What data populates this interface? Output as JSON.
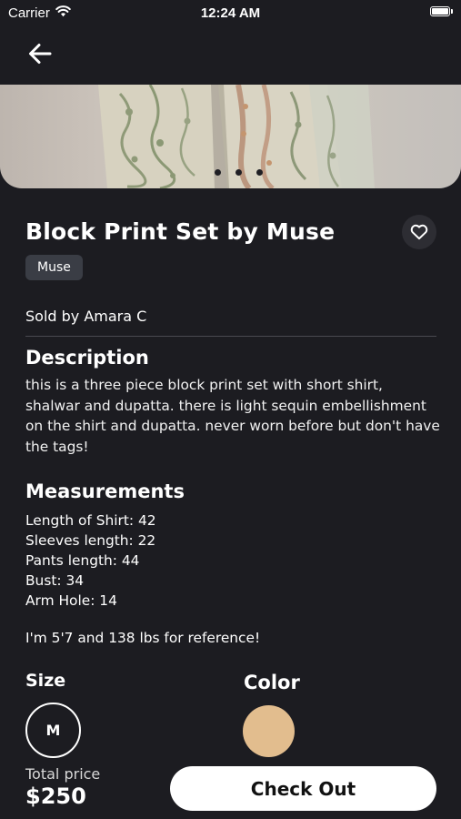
{
  "status_bar": {
    "carrier": "Carrier",
    "time": "12:24 AM",
    "icons": [
      "wifi-icon",
      "battery-icon"
    ]
  },
  "navigation": {
    "back_icon": "arrow-left-icon"
  },
  "gallery": {
    "page_count": 3,
    "active_index": 0
  },
  "product": {
    "title": "Block Print Set by Muse",
    "brand_tag": "Muse",
    "seller_text": "Sold by Amara C",
    "favorite_icon": "heart-icon"
  },
  "description": {
    "heading": "Description",
    "text": "this is a three piece block print set with short shirt, shalwar and dupatta. there is light sequin embellishment on the shirt and dupatta. never worn before but don't have the tags!"
  },
  "measurements": {
    "heading": "Measurements",
    "items": [
      "Length of Shirt: 42",
      "Sleeves length: 22",
      "Pants length: 44",
      "Bust: 34",
      "Arm Hole: 14"
    ],
    "reference": "I'm 5'7 and 138 lbs for reference!"
  },
  "options": {
    "size_label": "Size",
    "size_value": "M",
    "color_label": "Color",
    "color_hex": "#e2bd8e"
  },
  "checkout": {
    "total_label": "Total price",
    "total_value": "$250",
    "button_label": "Check Out"
  },
  "colors": {
    "background": "#1c1c21",
    "tag_background": "#3a3d45",
    "button_background": "#ffffff"
  }
}
